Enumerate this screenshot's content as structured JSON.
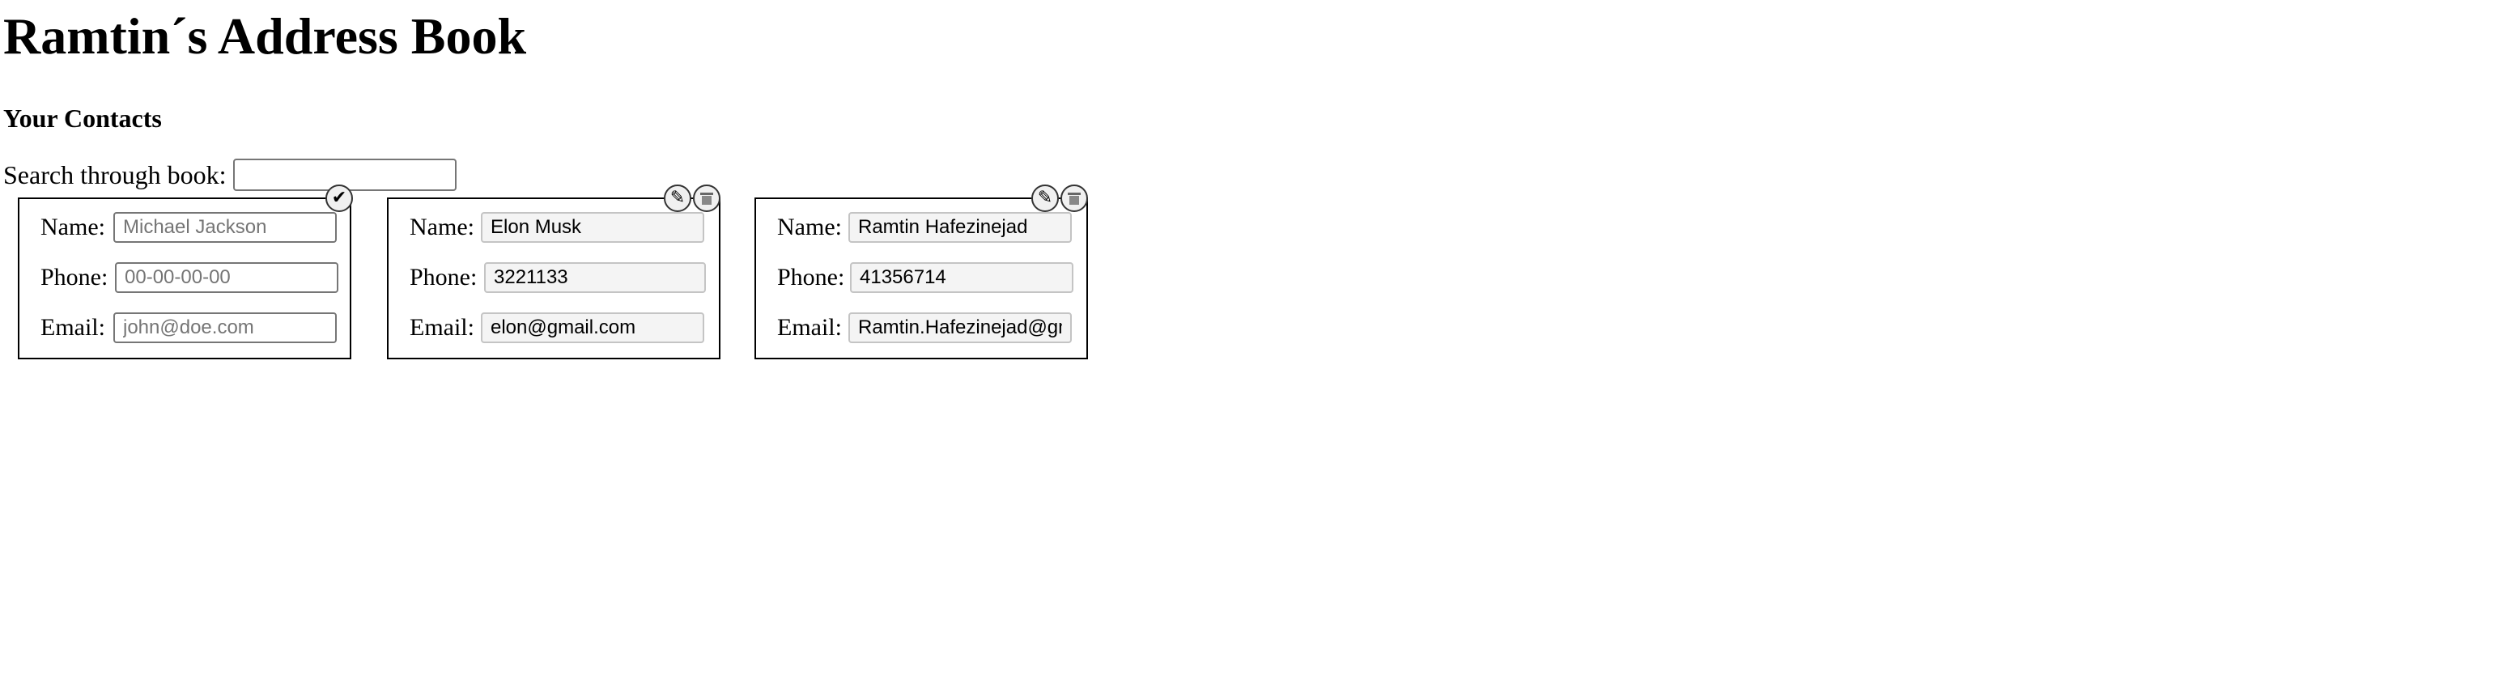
{
  "page": {
    "title": "Ramtin´s Address Book",
    "subtitle": "Your Contacts"
  },
  "search": {
    "label": "Search through book:",
    "value": ""
  },
  "labels": {
    "name": "Name:",
    "phone": "Phone:",
    "email": "Email:"
  },
  "new_contact": {
    "name_placeholder": "Michael Jackson",
    "phone_placeholder": "00-00-00-00",
    "email_placeholder": "john@doe.com",
    "save_icon": "checkmark-icon"
  },
  "contacts": [
    {
      "name": "Elon Musk",
      "phone": "3221133",
      "email": "elon@gmail.com",
      "edit_icon": "pencil-icon",
      "delete_icon": "trash-icon"
    },
    {
      "name": "Ramtin Hafezinejad",
      "phone": "41356714",
      "email": "Ramtin.Hafezinejad@gmail.com",
      "edit_icon": "pencil-icon",
      "delete_icon": "trash-icon"
    }
  ]
}
